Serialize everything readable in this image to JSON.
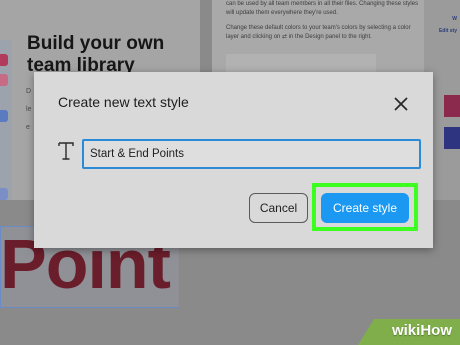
{
  "background_page": {
    "heading": "Build your own team library",
    "left_fragments": [
      "D",
      "le",
      "e"
    ],
    "right_paragraph_1": "can be used by all team members in all their files. Changing these styles will update them everywhere they're used.",
    "right_paragraph_2": "Change these default colors to your team's colors by selecting a color layer and clicking on ⇄ in the Design panel to the right.",
    "side_links": [
      "W",
      "Edit sty"
    ],
    "canvas_text": "Point"
  },
  "dialog": {
    "title": "Create new text style",
    "close_icon": "close-icon",
    "type_icon": "text-type-icon",
    "style_name_input": {
      "value": "Start & End Points",
      "placeholder": ""
    },
    "cancel_label": "Cancel",
    "create_label": "Create style"
  },
  "colors": {
    "accent": "#1a98f2",
    "highlight": "#3cff20",
    "canvas_text": "#6a1d2b"
  },
  "watermark": {
    "prefix": "wiki",
    "suffix": "How"
  }
}
